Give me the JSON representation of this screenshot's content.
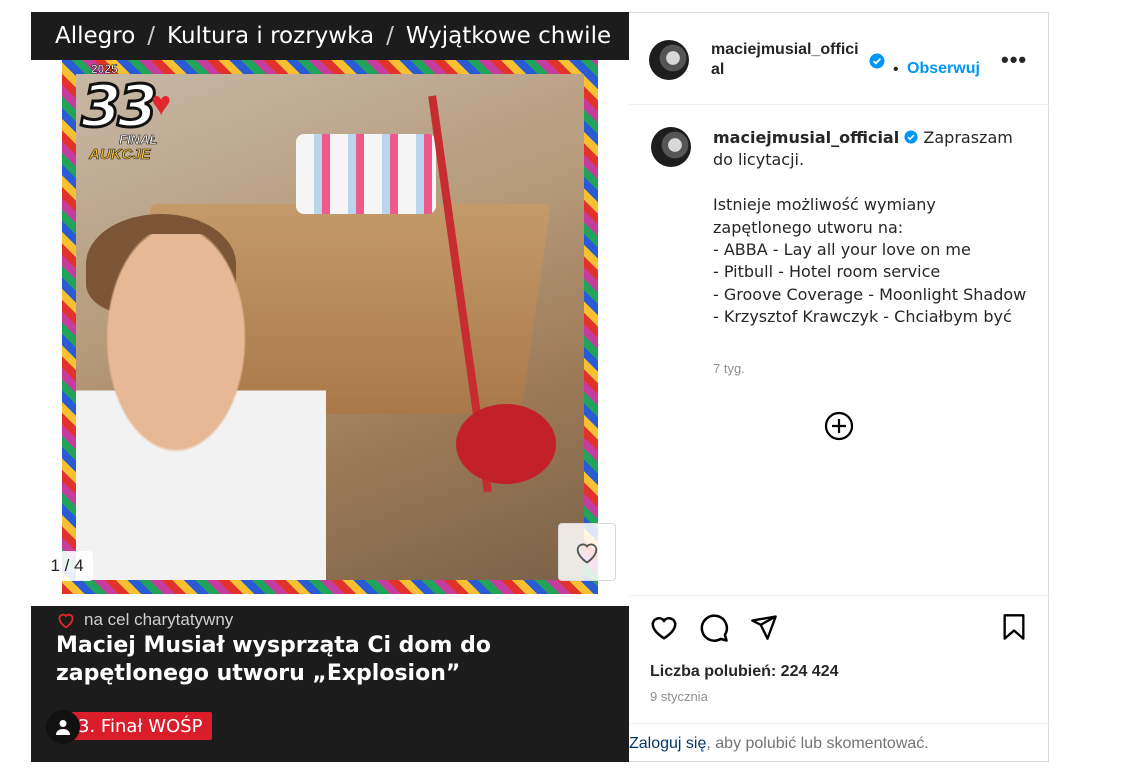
{
  "breadcrumb": {
    "items": [
      "Allegro",
      "Kultura i rozrywka",
      "Wyjątkowe chwile"
    ],
    "separator": "/"
  },
  "media": {
    "logo": {
      "year": "2025",
      "number": "33",
      "line1": "FINAŁ",
      "line2": "AUKCJE"
    },
    "counter": "1 / 4",
    "favorite_icon": "heart-outline-icon"
  },
  "offer": {
    "charity_label": "na cel charytatywny",
    "title": "Maciej Musiał wysprząta Ci dom do zapętlonego utworu „Explosion”",
    "badge": "33. Finał WOŚP",
    "badge_visible": "3. Finał WOŚP"
  },
  "post": {
    "header": {
      "username": "maciejmusial_official",
      "verified": true,
      "dot": "•",
      "follow_label": "Obserwuj",
      "more_icon": "more-horizontal-icon"
    },
    "caption": {
      "username": "maciejmusial_official",
      "text": "Zapraszam do licytacji.\n\nIstnieje możliwość wymiany zapętlonego utworu na:\n- ABBA - Lay all your love on me\n- Pitbull - Hotel room service\n- Groove Coverage - Moonlight Shadow\n- Krzysztof Krawczyk - Chciałbym być",
      "time": "7 tyg."
    },
    "load_more_icon": "plus-circle-icon",
    "actions": [
      "like-icon",
      "comment-icon",
      "share-icon",
      "save-icon"
    ],
    "likes_label": "Liczba polubień: 224 424",
    "date": "9 stycznia",
    "login": {
      "link": "Zaloguj się",
      "text": ", aby polubić lub skomentować."
    }
  },
  "colors": {
    "accent": "#0095f6",
    "wosp_red": "#d91d2b",
    "panel_dark": "#1c1c1c",
    "verified_blue": "#0095f6"
  }
}
